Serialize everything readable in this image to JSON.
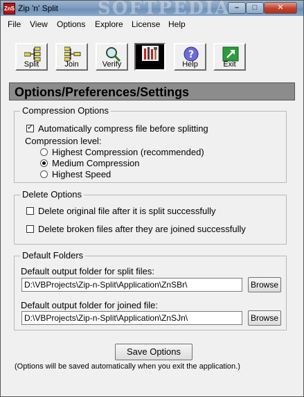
{
  "window": {
    "title": "Zip 'n' Split",
    "app_icon_text": "ZnS",
    "watermark": "SOFTPEDIA",
    "controls": {
      "minimize": "–",
      "maximize": "□",
      "close": "✕"
    }
  },
  "menu": [
    "File",
    "View",
    "Options",
    "Explore",
    "License",
    "Help"
  ],
  "toolbar": [
    {
      "label": "Split",
      "icon": "split-icon"
    },
    {
      "label": "Join",
      "icon": "join-icon"
    },
    {
      "label": "Verify",
      "icon": "magnifier-icon"
    },
    {
      "label": "",
      "icon": "tools-icon",
      "active": true
    },
    {
      "label": "Help",
      "icon": "help-icon"
    },
    {
      "label": "Exit",
      "icon": "exit-icon"
    }
  ],
  "heading": "Options/Preferences/Settings",
  "compression": {
    "legend": "Compression Options",
    "auto_compress_label": "Automatically compress file before splitting",
    "auto_compress_checked": true,
    "level_label": "Compression level:",
    "levels": [
      {
        "label": "Highest Compression (recommended)",
        "selected": false
      },
      {
        "label": "Medium Compression",
        "selected": true
      },
      {
        "label": "Highest Speed",
        "selected": false
      }
    ]
  },
  "delete": {
    "legend": "Delete Options",
    "delete_original_label": "Delete original file after it is split successfully",
    "delete_original_checked": false,
    "delete_broken_label": "Delete broken files after they are joined successfully",
    "delete_broken_checked": false
  },
  "folders": {
    "legend": "Default Folders",
    "split_label": "Default output folder for split files:",
    "split_value": "D:\\VBProjects\\Zip-n-Split\\Application\\ZnSBr\\",
    "joined_label": "Default output folder for joined file:",
    "joined_value": "D:\\VBProjects\\Zip-n-Split\\Application\\ZnSJn\\",
    "browse_label": "Browse"
  },
  "save_button": "Save Options",
  "footnote": "(Options will be saved automatically when you exit the application.)"
}
